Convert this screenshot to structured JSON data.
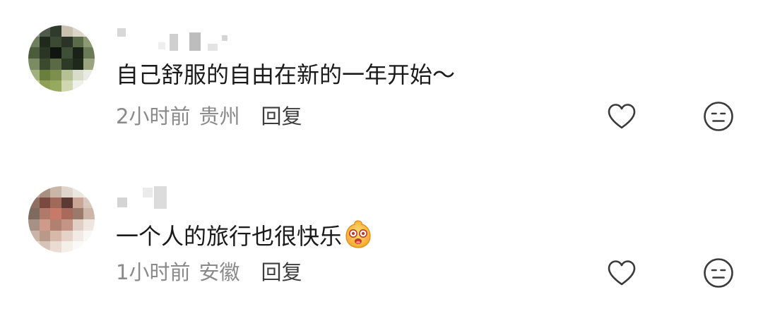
{
  "comments": [
    {
      "username": "",
      "text": "自己舒服的自由在新的一年开始～",
      "time": "2小时前",
      "location": "贵州",
      "reply_label": "回复",
      "like_icon": "heart-outline-icon",
      "dislike_icon": "meh-face-icon"
    },
    {
      "username": "",
      "text": "一个人的旅行也很快乐",
      "emoji": "happy-face-emoji",
      "time": "1小时前",
      "location": "安徽",
      "reply_label": "回复",
      "like_icon": "heart-outline-icon",
      "dislike_icon": "meh-face-icon"
    }
  ],
  "colors": {
    "content_text": "#1a1a1a",
    "meta_text": "#8a8a8a",
    "reply_text": "#3d3d3d",
    "icon_stroke": "#3a3a3a"
  }
}
